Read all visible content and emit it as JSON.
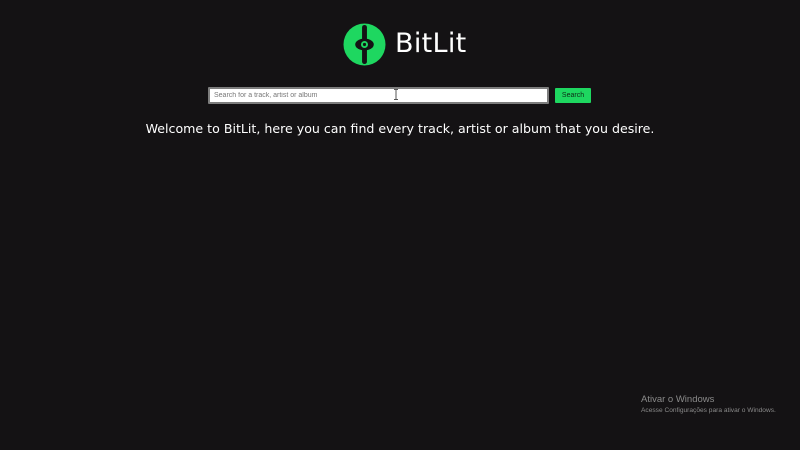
{
  "brand": {
    "name": "BitLit",
    "logo_icon": "bitlit-logo-icon",
    "accent_color": "#1ed760"
  },
  "search": {
    "placeholder": "Search for a track, artist or album",
    "value": "",
    "button_label": "Search"
  },
  "main": {
    "welcome_text": "Welcome to BitLit, here you can find every track, artist or album that you desire."
  },
  "system_overlay": {
    "title": "Ativar o Windows",
    "subtitle": "Acesse Configurações para ativar o Windows."
  }
}
